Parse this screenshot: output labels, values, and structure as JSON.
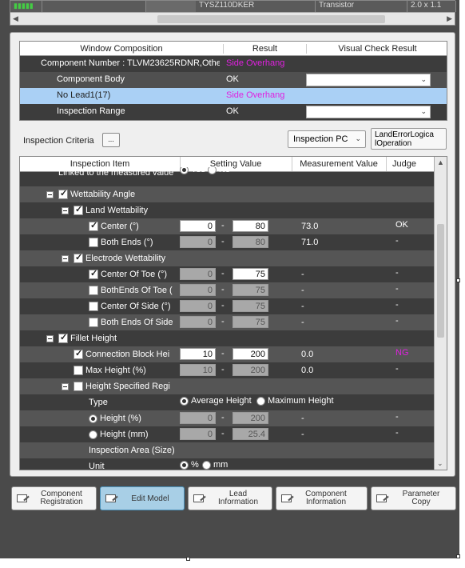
{
  "top_strip": {
    "cells": [
      "TYSZ110DKER",
      "Transistor",
      "2.0 x 1.1"
    ]
  },
  "window_composition": {
    "headers": [
      "Window Composition",
      "Result",
      "Visual Check Result"
    ],
    "rows": [
      {
        "label": "Component Number : TLVM23625RDNR,Othe",
        "result": "Side Overhang"
      },
      {
        "label": "Component Body",
        "result": "OK"
      },
      {
        "label": "No Lead1(17)",
        "result": "Side Overhang"
      },
      {
        "label": "Inspection Range",
        "result": "OK"
      }
    ]
  },
  "criteria": {
    "label": "Inspection Criteria",
    "button": "...",
    "pc_select": "Inspection PC",
    "land_button": "LandErrorLogica lOperation"
  },
  "table": {
    "headers": [
      "Inspection Item",
      "Setting Value",
      "Measurement Value",
      "Judge"
    ],
    "rows": [
      {
        "label": "Linked to the measured value",
        "opt1": "Yes",
        "opt2": "No"
      },
      {
        "label": "Wettability Angle"
      },
      {
        "label": "Land Wettability"
      },
      {
        "label": "Center (°)",
        "min": "0",
        "max": "80",
        "meas": "73.0",
        "judge": "OK"
      },
      {
        "label": "Both Ends (°)",
        "min": "0",
        "max": "80",
        "meas": "71.0",
        "judge": "-"
      },
      {
        "label": "Electrode Wettability"
      },
      {
        "label": "Center Of Toe (°)",
        "min": "0",
        "max": "75",
        "meas": "-",
        "judge": "-"
      },
      {
        "label": "BothEnds Of Toe (",
        "min": "0",
        "max": "75",
        "meas": "-",
        "judge": "-"
      },
      {
        "label": "Center Of Side (°)",
        "min": "0",
        "max": "75",
        "meas": "-",
        "judge": "-"
      },
      {
        "label": "Both Ends Of Side",
        "min": "0",
        "max": "75",
        "meas": "-",
        "judge": "-"
      },
      {
        "label": "Fillet Height"
      },
      {
        "label": "Connection Block Hei",
        "min": "10",
        "max": "200",
        "meas": "0.0",
        "judge": "NG"
      },
      {
        "label": "Max Height (%)",
        "min": "10",
        "max": "200",
        "meas": "0.0",
        "judge": "-"
      },
      {
        "label": "Height Specified Regi"
      },
      {
        "label": "Type",
        "opt1": "Average Height",
        "opt2": "Maximum Height"
      },
      {
        "label": "Height (%)",
        "min": "0",
        "max": "200",
        "meas": "-",
        "judge": "-"
      },
      {
        "label": "Height (mm)",
        "min": "0",
        "max": "25.4",
        "meas": "-",
        "judge": "-"
      },
      {
        "label": "Inspection Area (Size)"
      },
      {
        "label": "Unit",
        "opt1": "%",
        "opt2": "mm"
      }
    ],
    "separator": "-"
  },
  "buttons": {
    "component_registration": "Component Registration",
    "edit_model": "Edit Model",
    "lead_information": "Lead Information",
    "component_information": "Component Information",
    "parameter_copy": "Parameter Copy"
  },
  "colors": {
    "accent": "#a8cfe6",
    "ng": "#e020e0",
    "selected_row": "#aad0f5"
  }
}
